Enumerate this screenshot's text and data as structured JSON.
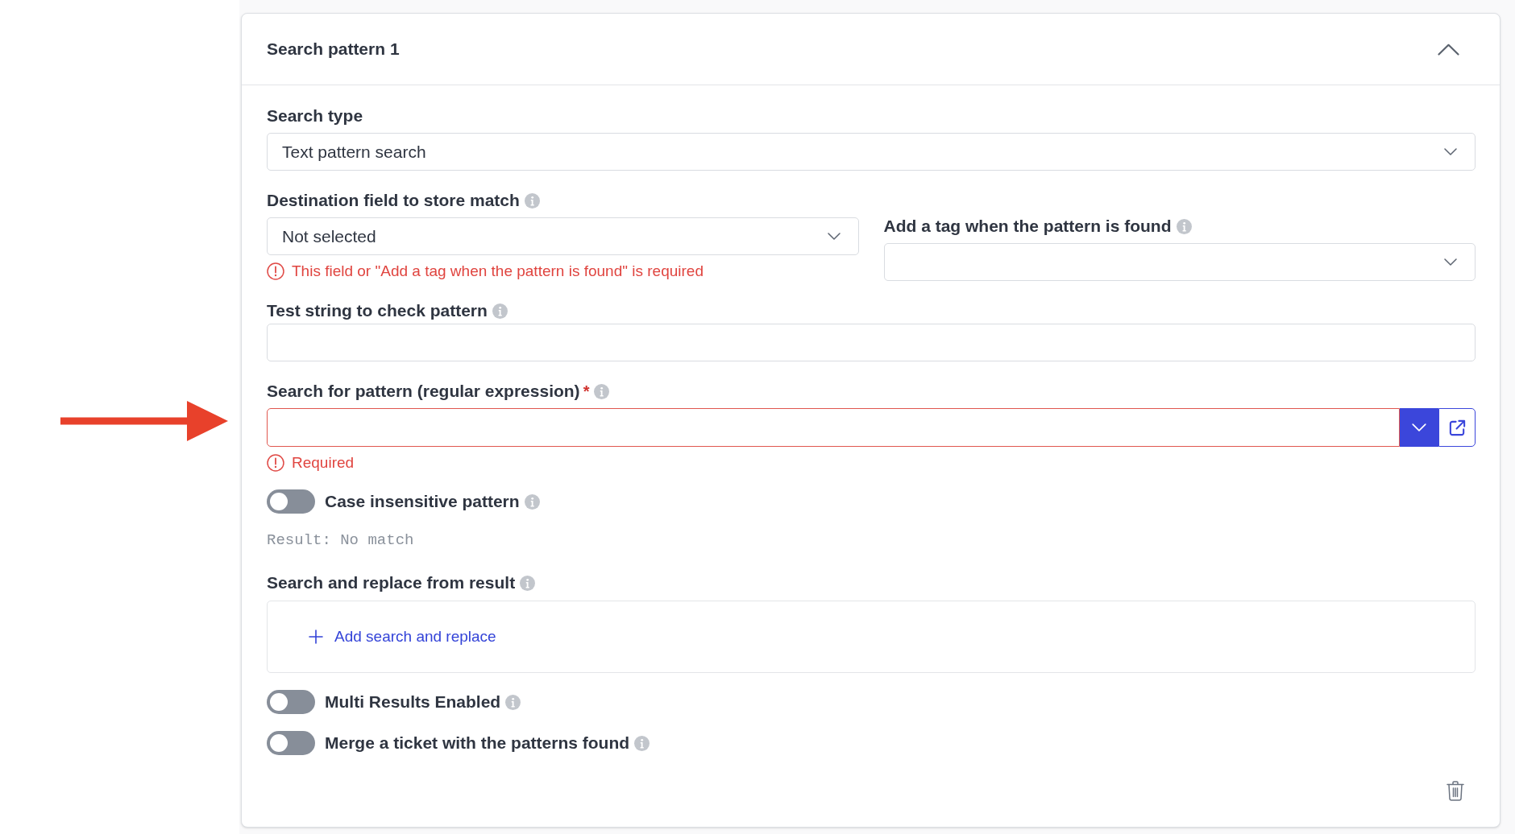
{
  "panel": {
    "title": "Search pattern 1",
    "expanded": true
  },
  "fields": [
    {
      "kind": "select",
      "label": "Search type",
      "value": "Text pattern search"
    },
    {
      "kind": "columns",
      "columns": [
        {
          "kind": "select",
          "label": "Destination field to store match",
          "info": true,
          "value": "Not selected",
          "error": "This field or \"Add a tag when the pattern is found\" is required"
        },
        {
          "kind": "select",
          "label": "Add a tag when the pattern is found",
          "info": true
        }
      ]
    },
    {
      "kind": "input",
      "label": "Test string to check pattern",
      "info": true
    },
    {
      "kind": "pattern",
      "label": "Search for pattern (regular expression)",
      "required_mark": "*",
      "info": true,
      "invalid": true,
      "error": "Required"
    },
    {
      "kind": "toggle",
      "label": "Case insensitive pattern",
      "info": true,
      "on": false
    },
    {
      "kind": "result",
      "text": "Result: No match"
    },
    {
      "kind": "replace_list",
      "label": "Search and replace from result",
      "info": true,
      "add_label": "Add search and replace"
    },
    {
      "kind": "toggle",
      "label": "Multi Results Enabled",
      "info": true,
      "on": false
    },
    {
      "kind": "toggle",
      "label": "Merge a ticket with the patterns found",
      "info": true,
      "on": false
    }
  ]
}
